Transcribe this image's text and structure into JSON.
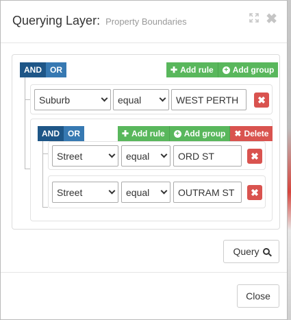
{
  "dialog": {
    "title": "Querying Layer:",
    "layer_name": "Property Boundaries",
    "expand_icon": "expand-icon",
    "close_icon": "close-icon"
  },
  "root_group": {
    "conditions": [
      "AND",
      "OR"
    ],
    "active_condition": "AND",
    "add_rule_label": "Add rule",
    "add_group_label": "Add group",
    "rules": [
      {
        "field": "Suburb",
        "operator": "equal",
        "value": "WEST PERTH"
      }
    ]
  },
  "nested_group": {
    "conditions": [
      "AND",
      "OR"
    ],
    "active_condition": "AND",
    "add_rule_label": "Add rule",
    "add_group_label": "Add group",
    "delete_label": "Delete",
    "rules": [
      {
        "field": "Street",
        "operator": "equal",
        "value": "ORD ST"
      },
      {
        "field": "Street",
        "operator": "equal",
        "value": "OUTRAM ST"
      }
    ]
  },
  "query_button": {
    "label": "Query",
    "icon": "search-icon"
  },
  "close_button": {
    "label": "Close"
  },
  "colors": {
    "condition_active": "#1e5687",
    "condition_inactive": "#3779b2",
    "add": "#59b75c",
    "delete": "#d9534f"
  }
}
